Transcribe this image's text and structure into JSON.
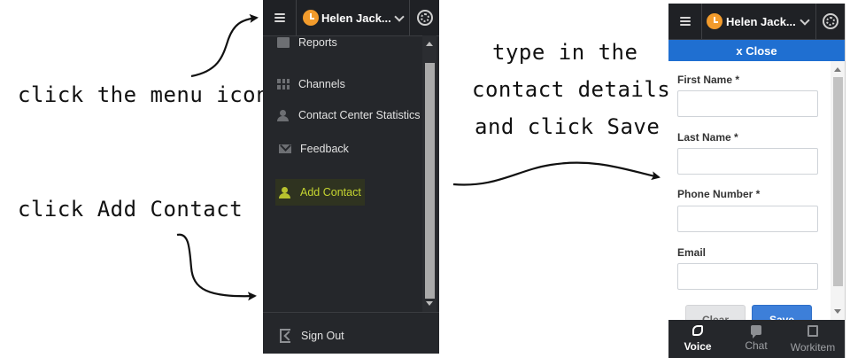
{
  "annotations": {
    "menu_icon": "click the menu icon",
    "add_contact": "click Add Contact",
    "details_line1": "type in the",
    "details_line2": "contact details",
    "details_line3": "and click Save"
  },
  "left_panel": {
    "user_name": "Helen Jack...",
    "status_color": "#f29b2c",
    "menu_items": [
      {
        "label": "Reports",
        "icon": "reports-icon"
      },
      {
        "label": "Channels",
        "icon": "channels-icon"
      },
      {
        "label": "Contact Center Statistics",
        "icon": "statistics-icon"
      },
      {
        "label": "Feedback",
        "icon": "feedback-icon"
      },
      {
        "label": "Add Contact",
        "icon": "add-contact-icon",
        "highlighted": true
      }
    ],
    "sign_out": "Sign Out",
    "highlight_color": "#c6d631"
  },
  "right_panel": {
    "user_name": "Helen Jack...",
    "close_label": "x Close",
    "accent_color": "#1f6fd1",
    "fields": [
      {
        "label": "First Name *",
        "value": ""
      },
      {
        "label": "Last Name *",
        "value": ""
      },
      {
        "label": "Phone Number *",
        "value": ""
      },
      {
        "label": "Email",
        "value": ""
      }
    ],
    "clear_label": "Clear",
    "save_label": "Save",
    "tabs": [
      {
        "label": "Voice",
        "icon": "phone-icon",
        "active": true
      },
      {
        "label": "Chat",
        "icon": "chat-icon",
        "active": false
      },
      {
        "label": "Workitem",
        "icon": "workitem-icon",
        "active": false
      }
    ]
  }
}
